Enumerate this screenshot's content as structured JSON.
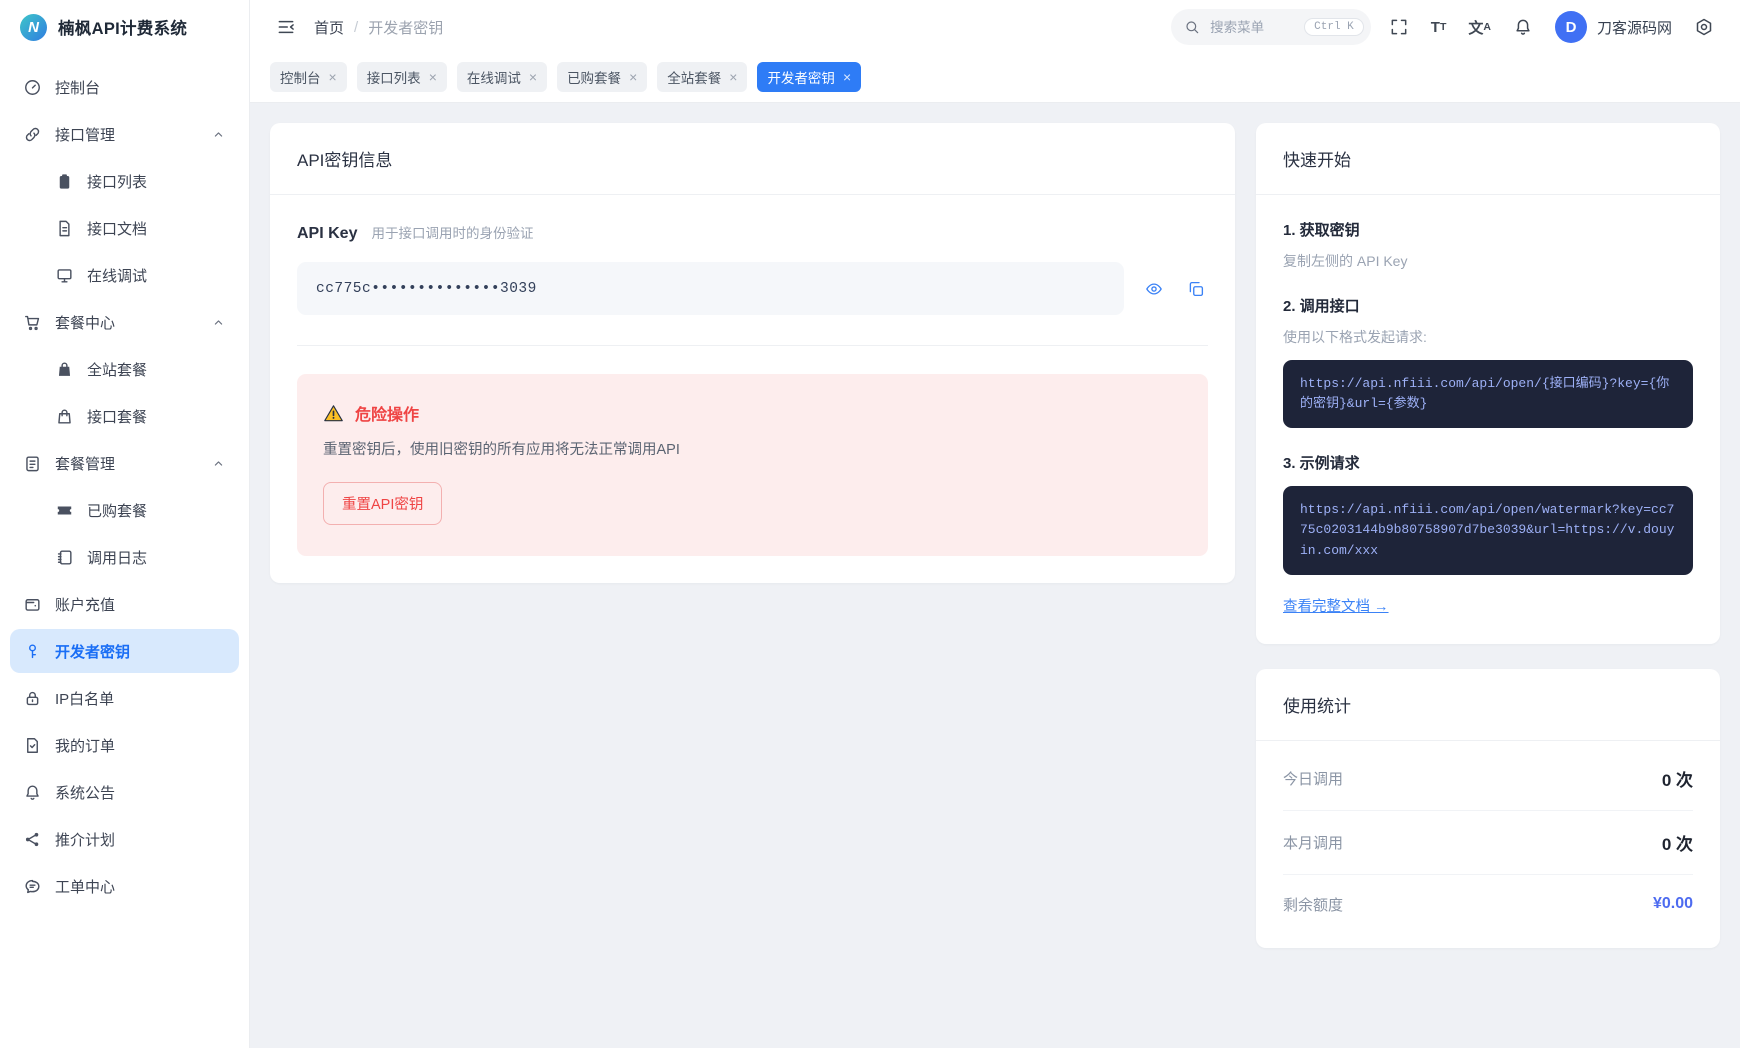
{
  "app": {
    "title": "楠枫API计费系统",
    "logo_letter": "N"
  },
  "breadcrumb": [
    "首页",
    "开发者密钥"
  ],
  "header": {
    "search_placeholder": "搜索菜单",
    "search_shortcut": "Ctrl K",
    "username": "刀客源码网",
    "avatar_letter": "D",
    "icons": [
      "collapse-sidebar",
      "search",
      "fullscreen",
      "font-size",
      "translate",
      "notifications",
      "settings"
    ]
  },
  "tabs": [
    {
      "label": "控制台",
      "active": false
    },
    {
      "label": "接口列表",
      "active": false
    },
    {
      "label": "在线调试",
      "active": false
    },
    {
      "label": "已购套餐",
      "active": false
    },
    {
      "label": "全站套餐",
      "active": false
    },
    {
      "label": "开发者密钥",
      "active": true
    }
  ],
  "sidebar": {
    "items": [
      {
        "label": "控制台",
        "icon": "dashboard-icon"
      },
      {
        "label": "接口管理",
        "icon": "api-link-icon",
        "expanded": true,
        "children": [
          "接口列表",
          "接口文档",
          "在线调试"
        ]
      },
      {
        "label": "套餐中心",
        "icon": "cart-icon",
        "expanded": true,
        "children": [
          "全站套餐",
          "接口套餐"
        ]
      },
      {
        "label": "套餐管理",
        "icon": "package-manage-icon",
        "expanded": true,
        "children": [
          "已购套餐",
          "调用日志"
        ]
      },
      {
        "label": "账户充值",
        "icon": "wallet-icon"
      },
      {
        "label": "开发者密钥",
        "icon": "key-icon",
        "active": true
      },
      {
        "label": "IP白名单",
        "icon": "lock-icon"
      },
      {
        "label": "我的订单",
        "icon": "orders-icon"
      },
      {
        "label": "系统公告",
        "icon": "announcement-icon"
      },
      {
        "label": "推介计划",
        "icon": "referral-icon"
      },
      {
        "label": "工单中心",
        "icon": "ticket-center-icon"
      }
    ]
  },
  "main": {
    "title": "API密钥信息",
    "api_key_label": "API Key",
    "api_key_desc": "用于接口调用时的身份验证",
    "api_key_masked": "cc775c••••••••••••••3039",
    "danger": {
      "title": "危险操作",
      "desc": "重置密钥后，使用旧密钥的所有应用将无法正常调用API",
      "button_label": "重置API密钥"
    }
  },
  "quickstart": {
    "title": "快速开始",
    "steps": [
      {
        "title": "1. 获取密钥",
        "desc": "复制左侧的 API Key"
      },
      {
        "title": "2. 调用接口",
        "desc": "使用以下格式发起请求:",
        "code": "https://api.nfiii.com/api/open/{接口编码}?key={你的密钥}&url={参数}"
      },
      {
        "title": "3. 示例请求",
        "code": "https://api.nfiii.com/api/open/watermark?key=cc775c0203144b9b80758907d7be3039&url=https://v.douyin.com/xxx"
      }
    ],
    "doc_link_label": "查看完整文档 →"
  },
  "stats": {
    "title": "使用统计",
    "rows": [
      {
        "label": "今日调用",
        "value": "0 次"
      },
      {
        "label": "本月调用",
        "value": "0 次"
      },
      {
        "label": "剩余额度",
        "value": "¥0.00",
        "highlight": true
      }
    ]
  },
  "colors": {
    "accent": "#2e7cf6",
    "sidebar_active_bg": "#d8e9fd",
    "sidebar_active_text": "#1a6ef5",
    "danger": "#ef4444",
    "danger_bg": "#fdeded",
    "code_bg": "#1e2439",
    "code_text": "#9db0f6",
    "money": "#4d6bf0",
    "warning": "#fbbf24",
    "avatar_bg": "#4070f4",
    "page_bg": "#eff1f5"
  }
}
